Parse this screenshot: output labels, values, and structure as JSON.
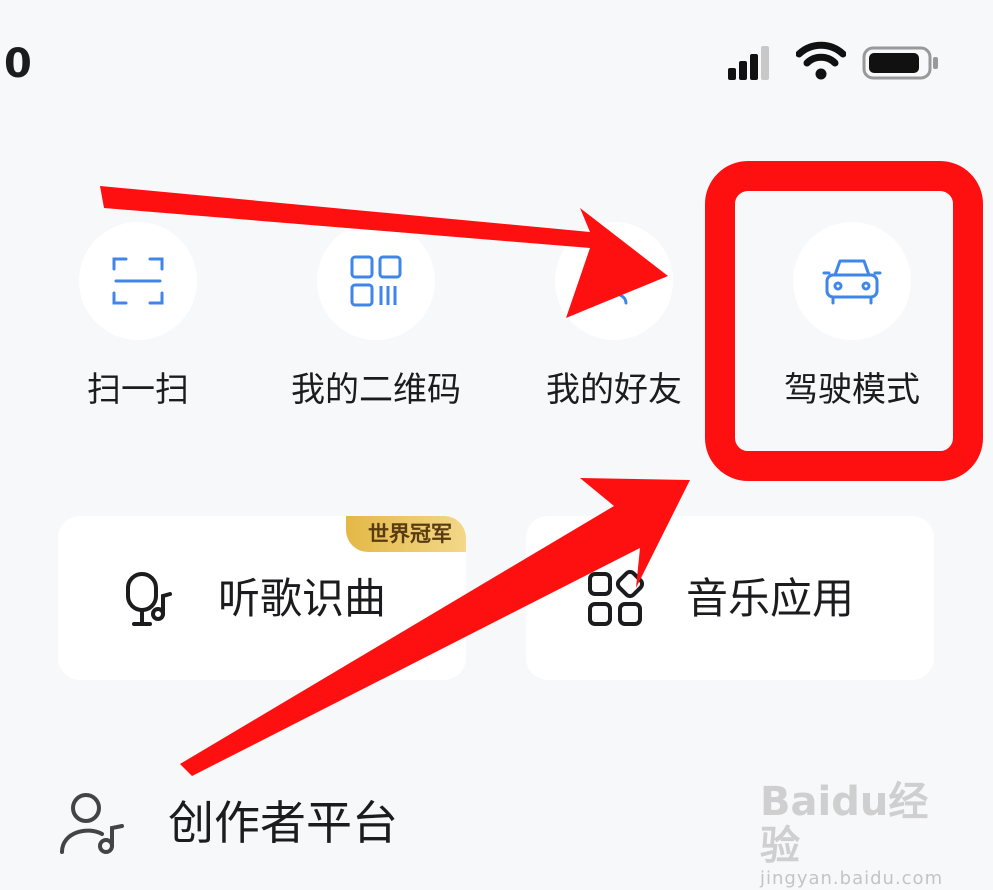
{
  "status_bar": {
    "time": "0"
  },
  "quick_actions": [
    {
      "label": "扫一扫",
      "icon": "scan-icon"
    },
    {
      "label": "我的二维码",
      "icon": "qr-code-icon"
    },
    {
      "label": "我的好友",
      "icon": "friends-icon"
    },
    {
      "label": "驾驶模式",
      "icon": "car-icon"
    }
  ],
  "cards": [
    {
      "label": "听歌识曲",
      "icon": "music-recognition-icon",
      "badge": "世界冠军"
    },
    {
      "label": "音乐应用",
      "icon": "apps-grid-icon"
    }
  ],
  "creator": {
    "label": "创作者平台",
    "icon": "creator-icon"
  },
  "watermark": {
    "brand": "Baidu",
    "brand_cn": "经验",
    "url": "jingyan.baidu.com"
  },
  "colors": {
    "icon_blue": "#3f86e9",
    "annotation_red": "#ff1010",
    "badge_gold": "#e3b846"
  }
}
